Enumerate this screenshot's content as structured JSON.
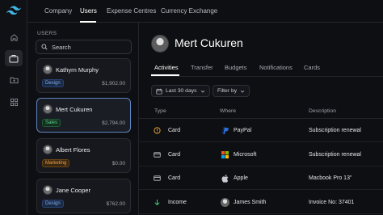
{
  "topnav": {
    "tabs": [
      "Company",
      "Users",
      "Expense Centres",
      "Currency Exchange"
    ],
    "active": "Users"
  },
  "users_panel": {
    "section_label": "USERS",
    "search_placeholder": "Search",
    "users": [
      {
        "name": "Kathyrn Murphy",
        "role": "Design",
        "amount": "$1,902.00",
        "selected": false
      },
      {
        "name": "Mert Cukuren",
        "role": "Sales",
        "amount": "$2,794.00",
        "selected": true
      },
      {
        "name": "Albert Flores",
        "role": "Marketing",
        "amount": "$0.00",
        "selected": false
      },
      {
        "name": "Jane Cooper",
        "role": "Design",
        "amount": "$762.00",
        "selected": false
      }
    ]
  },
  "profile": {
    "name": "Mert Cukuren"
  },
  "subtabs": [
    "Activities",
    "Transfer",
    "Budgets",
    "Notifications",
    "Cards"
  ],
  "filters": {
    "date": "Last 30 days",
    "filter": "Filter by"
  },
  "table": {
    "headers": [
      "Type",
      "Where",
      "Description"
    ],
    "rows": [
      {
        "type": "Card",
        "where": "PayPal",
        "description": "Subscription renewal",
        "type_icon": "pending-clock-icon",
        "where_icon": "paypal-icon"
      },
      {
        "type": "Card",
        "where": "Microsoft",
        "description": "Subscription renewal",
        "type_icon": "card-icon",
        "where_icon": "microsoft-icon"
      },
      {
        "type": "Card",
        "where": "Apple",
        "description": "Macbook Pro 13\"",
        "type_icon": "card-icon",
        "where_icon": "apple-icon"
      },
      {
        "type": "Income",
        "where": "James Smith",
        "description": "Invoice No: 37401",
        "type_icon": "income-arrow-icon",
        "where_icon": "avatar"
      }
    ]
  },
  "colors": {
    "accent": "#5f84c4",
    "sales": "#5fd08a",
    "design": "#7fa8ec",
    "marketing": "#f0a14a",
    "pending": "#e9a23b",
    "income": "#3ecf7b"
  }
}
